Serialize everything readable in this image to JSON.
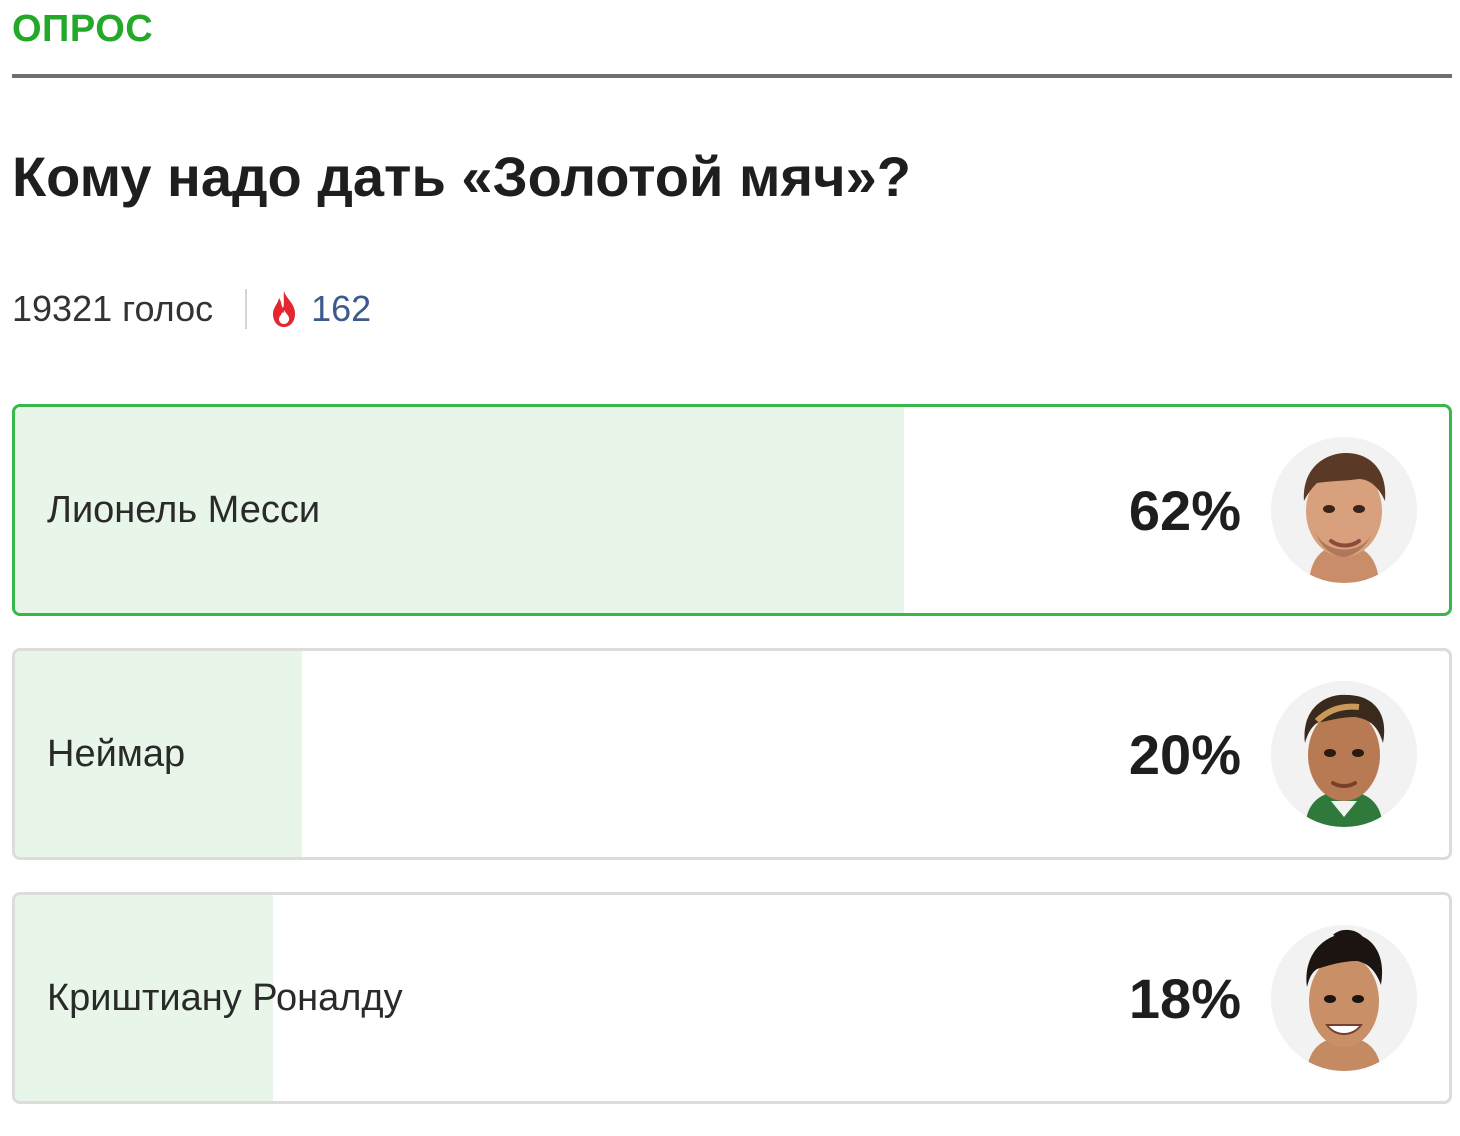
{
  "poll": {
    "section_label": "ОПРОС",
    "question": "Кому надо дать «Золотой мяч»?",
    "votes_text": "19321 голос",
    "fire_count": "162",
    "fire_icon": "fire-icon",
    "accent_color": "#23a82a",
    "options": [
      {
        "label": "Лионель Месси",
        "percent_text": "62%",
        "percent": 62,
        "selected": true,
        "avatar_icon": "player-photo"
      },
      {
        "label": "Неймар",
        "percent_text": "20%",
        "percent": 20,
        "selected": false,
        "avatar_icon": "player-photo"
      },
      {
        "label": "Криштиану Роналду",
        "percent_text": "18%",
        "percent": 18,
        "selected": false,
        "avatar_icon": "player-photo"
      }
    ]
  }
}
